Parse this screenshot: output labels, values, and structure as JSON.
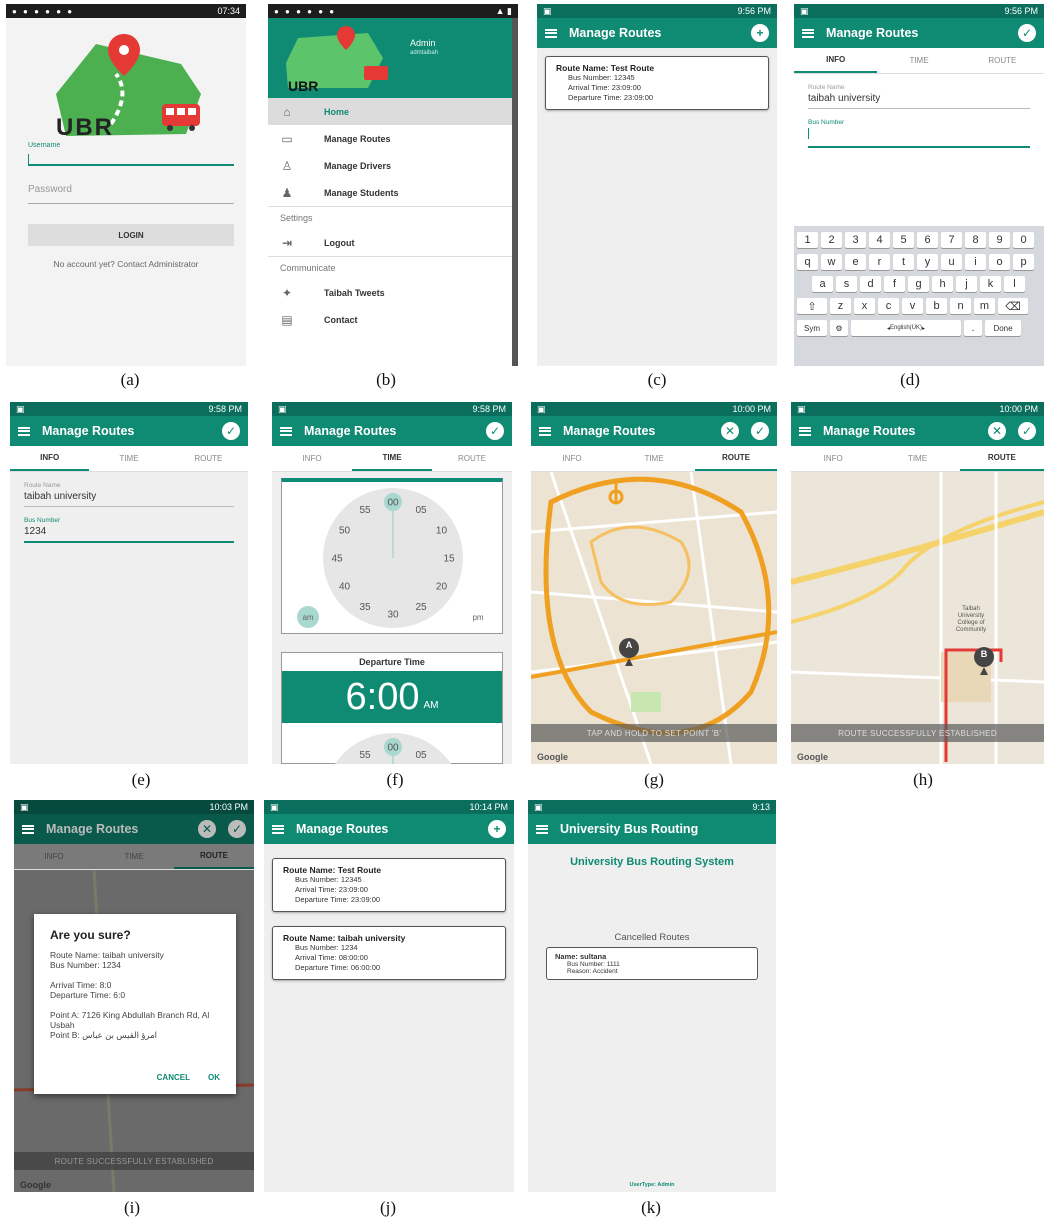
{
  "captions": [
    "(a)",
    "(b)",
    "(c)",
    "(d)",
    "(e)",
    "(f)",
    "(g)",
    "(h)",
    "(i)",
    "(j)",
    "(k)"
  ],
  "login": {
    "status_time": "07:34",
    "logo_text": "UBR",
    "username_label": "Username",
    "password_placeholder": "Password",
    "login_button": "LOGIN",
    "footer": "No account yet? Contact Administrator"
  },
  "drawer": {
    "logo_text": "UBR",
    "user_name": "Admin",
    "user_email": "admtaibah",
    "items": [
      "Home",
      "Manage Routes",
      "Manage Drivers",
      "Manage Students"
    ],
    "settings_label": "Settings",
    "logout": "Logout",
    "communicate_label": "Communicate",
    "tweets": "Taibah Tweets",
    "contact": "Contact"
  },
  "screen_c": {
    "status_time": "9:56 PM",
    "title": "Manage Routes",
    "route": {
      "name": "Route Name: Test Route",
      "bus": "Bus Number: 12345",
      "arrival": "Arrival Time: 23:09:00",
      "departure": "Departure Time: 23:09:00"
    }
  },
  "tabs": [
    "INFO",
    "TIME",
    "ROUTE"
  ],
  "screen_d": {
    "status_time": "9:56 PM",
    "title": "Manage Routes",
    "route_name_label": "Route Name",
    "route_name_value": "taibah university",
    "bus_number_label": "Bus Number",
    "bus_number_value": "",
    "keyboard": {
      "row1": [
        "1",
        "2",
        "3",
        "4",
        "5",
        "6",
        "7",
        "8",
        "9",
        "0"
      ],
      "row2": [
        "q",
        "w",
        "e",
        "r",
        "t",
        "y",
        "u",
        "i",
        "o",
        "p"
      ],
      "row3": [
        "a",
        "s",
        "d",
        "f",
        "g",
        "h",
        "j",
        "k",
        "l"
      ],
      "row4": [
        "z",
        "x",
        "c",
        "v",
        "b",
        "n",
        "m"
      ],
      "sym": "Sym",
      "space": "English(UK)",
      "done": "Done"
    }
  },
  "screen_e": {
    "status_time": "9:58 PM",
    "title": "Manage Routes",
    "route_name_label": "Route Name",
    "route_name_value": "taibah university",
    "bus_number_label": "Bus Number",
    "bus_number_value": "1234"
  },
  "screen_f": {
    "status_time": "9:58 PM",
    "title": "Manage Routes",
    "clock_minutes": [
      "00",
      "05",
      "10",
      "15",
      "20",
      "25",
      "30",
      "35",
      "40",
      "45",
      "50",
      "55"
    ],
    "am": "am",
    "pm": "pm",
    "departure_label": "Departure Time",
    "departure_time": "6:00",
    "departure_ampm": "AM"
  },
  "screen_g": {
    "status_time": "10:00 PM",
    "title": "Manage Routes",
    "marker": "A",
    "toast": "TAP AND HOLD TO SET POINT 'B'",
    "google": "Google"
  },
  "screen_h": {
    "status_time": "10:00 PM",
    "title": "Manage Routes",
    "marker": "B",
    "toast": "ROUTE SUCCESSFULLY ESTABLISHED",
    "google": "Google",
    "map_labels": [
      "Taibah University College of Community"
    ]
  },
  "screen_i": {
    "status_time": "10:03 PM",
    "title": "Manage Routes",
    "dialog_title": "Are you sure?",
    "lines": [
      "Route Name: taibah university",
      "Bus Number: 1234",
      "Arrival Time: 8:0",
      "Departure Time: 6:0",
      "Point A: 7126 King Abdullah Branch Rd, Al Usbah",
      "Point B: امرؤ القيس بن عباس"
    ],
    "cancel": "CANCEL",
    "ok": "OK",
    "toast": "ROUTE SUCCESSFULLY ESTABLISHED",
    "google": "Google"
  },
  "screen_j": {
    "status_time": "10:14 PM",
    "title": "Manage Routes",
    "routes": [
      {
        "name": "Route Name: Test Route",
        "bus": "Bus Number: 12345",
        "arrival": "Arrival Time: 23:09:00",
        "departure": "Departure Time: 23:09:00"
      },
      {
        "name": "Route Name: taibah university",
        "bus": "Bus Number: 1234",
        "arrival": "Arrival Time: 08:00:00",
        "departure": "Departure Time: 06:00:00"
      }
    ]
  },
  "screen_k": {
    "status_time": "9:13",
    "title": "University Bus Routing",
    "heading": "University Bus Routing System",
    "cancelled_label": "Cancelled Routes",
    "card": {
      "name": "Name: sultana",
      "bus": "Bus Number: 1111",
      "reason": "Reason: Accident"
    },
    "footer": "UserType: Admin"
  }
}
